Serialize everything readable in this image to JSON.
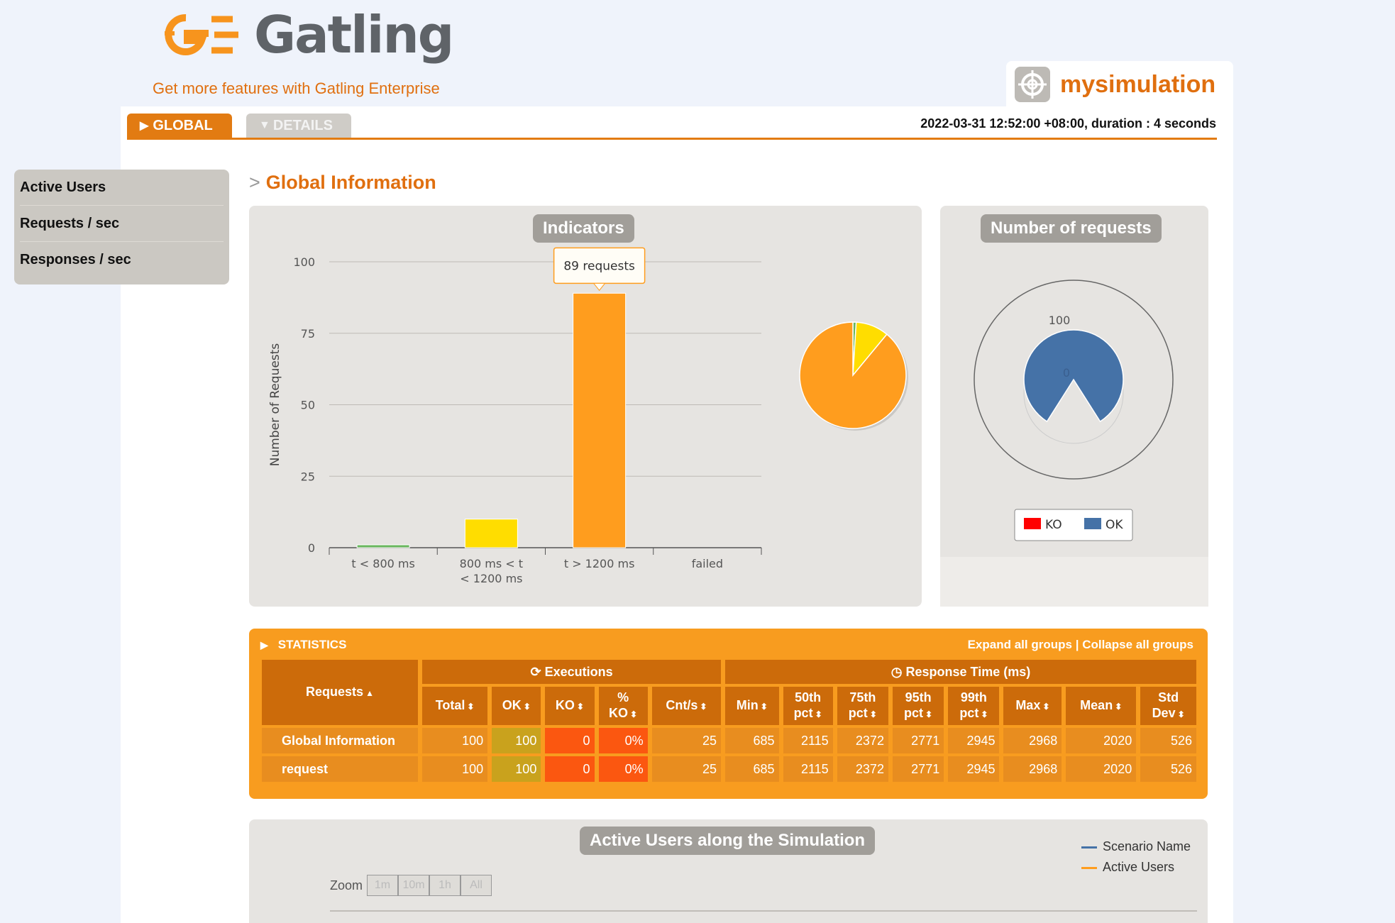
{
  "header": {
    "brand": "Gatling",
    "enterprise_link": "Get more features with Gatling Enterprise",
    "simulation_name": "mysimulation",
    "run_info": "2022-03-31 12:52:00 +08:00, duration : 4 seconds"
  },
  "tabs": {
    "global": "GLOBAL",
    "details": "DETAILS"
  },
  "menu": {
    "items": [
      {
        "label": "Active Users"
      },
      {
        "label": "Requests / sec"
      },
      {
        "label": "Responses / sec"
      }
    ]
  },
  "section_title": "Global Information",
  "colors": {
    "accent": "#e27b12",
    "ok": "#4572a7",
    "ko": "#ff0000",
    "fast": "#68b65c",
    "medium": "#ffdd00",
    "slow": "#ff9d1e"
  },
  "indicators": {
    "title": "Indicators",
    "tooltip": "89 requests",
    "chart_data": {
      "type": "bar",
      "title": "",
      "ylabel": "Number of Requests",
      "ylim": [
        0,
        100
      ],
      "yticks": [
        "0",
        "25",
        "50",
        "75",
        "100"
      ],
      "categories": [
        "t < 800 ms",
        "800 ms < t < 1200 ms",
        "t > 1200 ms",
        "failed"
      ],
      "values": [
        1,
        10,
        89,
        0
      ],
      "bar_colors": [
        "#68b65c",
        "#ffdd00",
        "#ff9d1e",
        "#ff0000"
      ],
      "pie_values": [
        1,
        10,
        89,
        0
      ]
    }
  },
  "requests_pie": {
    "title": "Number of requests",
    "chart_data": {
      "type": "pie",
      "title": "",
      "series": [
        {
          "name": "KO",
          "value": 0,
          "color": "#ff0000"
        },
        {
          "name": "OK",
          "value": 100,
          "color": "#4572a7"
        }
      ],
      "labels": [
        "100",
        "0"
      ]
    }
  },
  "statistics": {
    "title": "STATISTICS",
    "expand_label": "Expand all groups",
    "separator": "|",
    "collapse_label": "Collapse all groups",
    "executions_label": "Executions",
    "response_time_label": "Response Time (ms)",
    "requests_header": "Requests",
    "columns": [
      [
        "Total"
      ],
      [
        "OK"
      ],
      [
        "KO"
      ],
      [
        "%",
        "KO"
      ],
      [
        "Cnt/s"
      ],
      [
        "Min"
      ],
      [
        "50th",
        "pct"
      ],
      [
        "75th",
        "pct"
      ],
      [
        "95th",
        "pct"
      ],
      [
        "99th",
        "pct"
      ],
      [
        "Max"
      ],
      [
        "Mean"
      ],
      [
        "Std",
        "Dev"
      ]
    ],
    "rows": [
      {
        "name": "Global Information",
        "values": [
          "100",
          "100",
          "0",
          "0%",
          "25",
          "685",
          "2115",
          "2372",
          "2771",
          "2945",
          "2968",
          "2020",
          "526"
        ]
      },
      {
        "name": "request",
        "values": [
          "100",
          "100",
          "0",
          "0%",
          "25",
          "685",
          "2115",
          "2372",
          "2771",
          "2945",
          "2968",
          "2020",
          "526"
        ]
      }
    ]
  },
  "active_users": {
    "title": "Active Users along the Simulation",
    "zoom_label": "Zoom",
    "zoom_buttons": [
      "1m",
      "10m",
      "1h",
      "All"
    ],
    "legend": [
      {
        "name": "Scenario Name",
        "color": "#4572a7"
      },
      {
        "name": "Active Users",
        "color": "#ff9d1e"
      }
    ]
  }
}
